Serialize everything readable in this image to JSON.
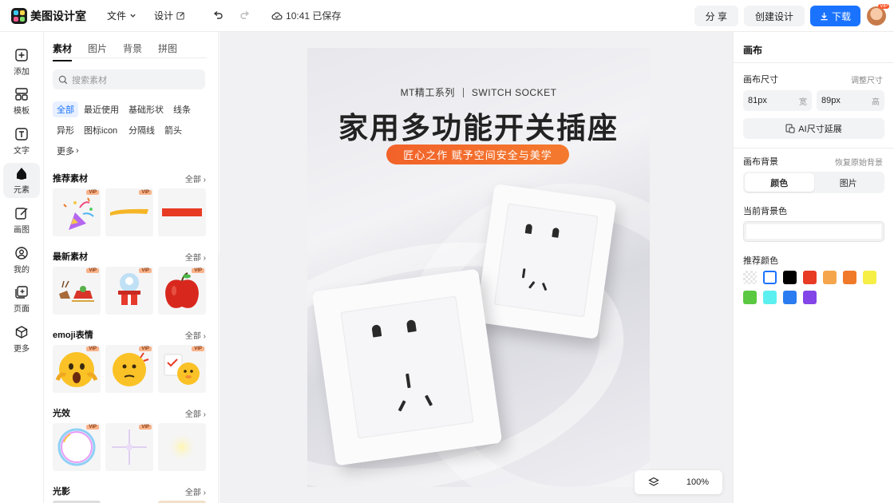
{
  "app": {
    "name": "美图设计室"
  },
  "topbar": {
    "file": "文件",
    "design": "设计",
    "saved": "10:41 已保存",
    "share": "分 享",
    "create": "创建设计",
    "download": "下载",
    "vip": "VIP"
  },
  "leftnav": [
    "添加",
    "模板",
    "文字",
    "元素",
    "画图",
    "我的",
    "页面",
    "更多"
  ],
  "panel": {
    "tabs": [
      "素材",
      "图片",
      "背景",
      "拼图"
    ],
    "search_placeholder": "搜索素材",
    "chips": [
      "全部",
      "最近使用",
      "基础形状",
      "线条",
      "异形",
      "图标icon",
      "分隔线",
      "箭头",
      "更多"
    ],
    "all": "全部",
    "sections": [
      "推荐素材",
      "最新素材",
      "emoji表情",
      "光效",
      "光影"
    ],
    "vip": "VIP"
  },
  "poster": {
    "subtitle_left": "MT精工系列",
    "subtitle_right": "SWITCH SOCKET",
    "title": "家用多功能开关插座",
    "tagline": "匠心之作 赋予空间安全与美学"
  },
  "zoom": "100%",
  "right": {
    "title": "画布",
    "size_label": "画布尺寸",
    "adjust": "调整尺寸",
    "width_value": "81px",
    "width_unit": "宽",
    "height_value": "89px",
    "height_unit": "高",
    "ai_btn": "AI尺寸延展",
    "bg_label": "画布背景",
    "restore": "恢复原始背景",
    "seg_color": "颜色",
    "seg_image": "图片",
    "current_bg": "当前背景色",
    "recommend": "推荐颜色",
    "swatches": [
      "transparent",
      "#ffffff",
      "#000000",
      "#e83b24",
      "#f5a64c",
      "#f07a2a",
      "#f5ef46",
      "#5ac840",
      "#5bf0ef",
      "#2a7cf0",
      "#8345e8"
    ]
  },
  "colors": {
    "accent": "#1a73ff",
    "pill": "#f2622a"
  }
}
